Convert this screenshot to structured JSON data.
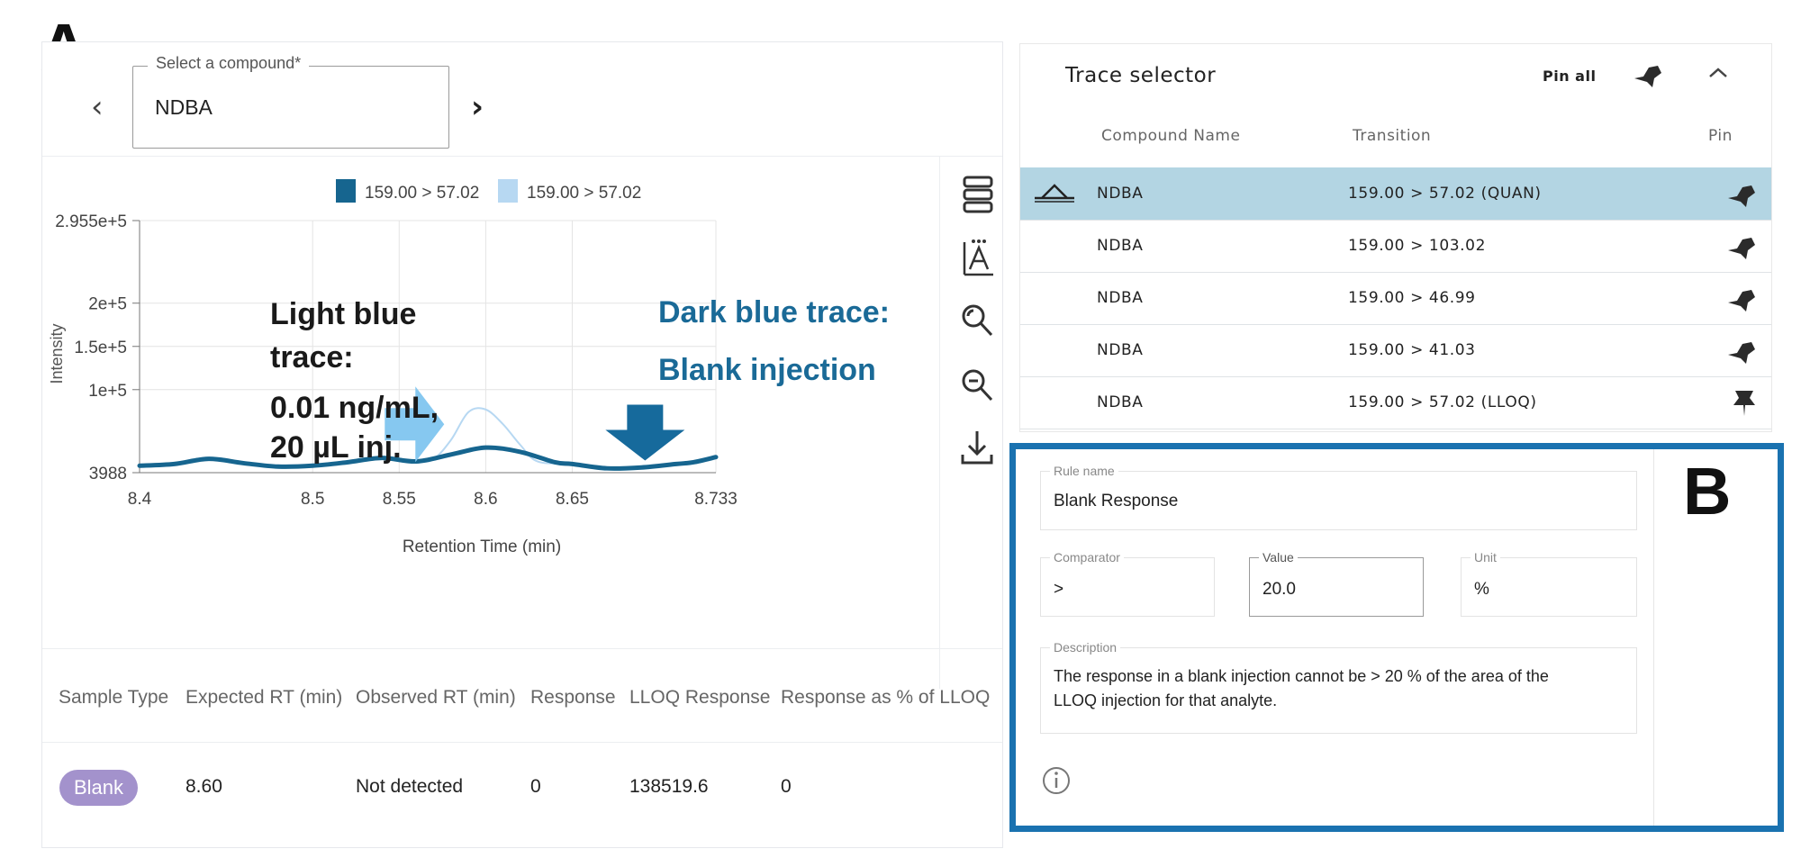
{
  "panel_labels": {
    "a": "A",
    "b": "B"
  },
  "compound_selector": {
    "label": "Select a compound*",
    "value": "NDBA",
    "prev_icon": "‹",
    "next_icon": "›"
  },
  "chart_data": {
    "type": "line",
    "legend": [
      {
        "label": "159.00 > 57.02",
        "color": "#16658f"
      },
      {
        "label": "159.00 > 57.02",
        "color": "#b7d8f2"
      }
    ],
    "xlabel": "Retention Time (min)",
    "ylabel": "Intensity",
    "xlim": [
      8.4,
      8.733
    ],
    "ylim": [
      3988,
      295500
    ],
    "x_ticks": [
      "8.4",
      "8.5",
      "8.55",
      "8.6",
      "8.65",
      "8.733"
    ],
    "x_tick_values": [
      8.4,
      8.5,
      8.55,
      8.6,
      8.65,
      8.733
    ],
    "y_ticks": [
      "2.955e+5",
      "2e+5",
      "1.5e+5",
      "1e+5",
      "3988"
    ],
    "y_tick_values": [
      295500,
      200000,
      150000,
      100000,
      3988
    ],
    "series": [
      {
        "color": "#b7d8f2",
        "width": 2,
        "x": [
          8.4,
          8.42,
          8.44,
          8.46,
          8.48,
          8.5,
          8.52,
          8.54,
          8.56,
          8.57,
          8.58,
          8.59,
          8.6,
          8.61,
          8.62,
          8.63,
          8.65,
          8.67,
          8.69,
          8.71,
          8.72,
          8.733
        ],
        "y": [
          12000,
          14000,
          20000,
          15000,
          11000,
          12000,
          16000,
          21000,
          17000,
          20000,
          42000,
          74000,
          77000,
          60000,
          36000,
          17000,
          14000,
          9000,
          10000,
          14000,
          16000,
          22000
        ]
      },
      {
        "color": "#16658f",
        "width": 5,
        "x": [
          8.4,
          8.42,
          8.44,
          8.46,
          8.48,
          8.5,
          8.52,
          8.54,
          8.56,
          8.58,
          8.6,
          8.62,
          8.64,
          8.65,
          8.67,
          8.69,
          8.71,
          8.72,
          8.733
        ],
        "y": [
          12000,
          14000,
          20000,
          15000,
          11000,
          12000,
          16000,
          21000,
          17000,
          25000,
          33000,
          28000,
          16000,
          14000,
          9000,
          10000,
          14000,
          16000,
          22000
        ]
      }
    ],
    "annotations": {
      "light_line1": "Light blue",
      "light_line2": "trace:",
      "light_line3": "0.01 ng/mL,",
      "light_line4": "20 µL inj.",
      "dark_line1": "Dark blue trace:",
      "dark_line2": "Blank injection"
    },
    "arrow_colors": {
      "light": "#86c8f0",
      "dark": "#166a9c"
    }
  },
  "toolbar": {
    "icons": [
      "layers-icon",
      "auto-scale-icon",
      "zoom-in-icon",
      "zoom-out-icon",
      "download-icon"
    ]
  },
  "results_table": {
    "headers": [
      "Sample Type",
      "Expected RT (min)",
      "Observed RT (min)",
      "Response",
      "LLOQ Response",
      "Response as % of LLOQ"
    ],
    "row": {
      "sample_type": "Blank",
      "expected_rt": "8.60",
      "observed_rt": "Not detected",
      "response": "0",
      "lloq_response": "138519.6",
      "response_pct": "0"
    }
  },
  "trace_selector": {
    "title": "Trace selector",
    "pin_all": "Pin all",
    "headers": {
      "compound": "Compound Name",
      "transition": "Transition",
      "pin": "Pin"
    },
    "rows": [
      {
        "compound": "NDBA",
        "transition": "159.00 > 57.02 (QUAN)"
      },
      {
        "compound": "NDBA",
        "transition": "159.00 > 103.02"
      },
      {
        "compound": "NDBA",
        "transition": "159.00 > 46.99"
      },
      {
        "compound": "NDBA",
        "transition": "159.00 > 41.03"
      },
      {
        "compound": "NDBA",
        "transition": "159.00 > 57.02 (LLOQ)"
      }
    ]
  },
  "rule": {
    "rule_name_label": "Rule name",
    "rule_name": "Blank Response",
    "comparator_label": "Comparator",
    "comparator": ">",
    "value_label": "Value",
    "value": "20.0",
    "unit_label": "Unit",
    "unit": "%",
    "description_label": "Description",
    "description_line1": "The response in a blank injection cannot be > 20 % of the area of the",
    "description_line2": "LLOQ injection for that analyte."
  },
  "accent_color": "#1a72b0"
}
